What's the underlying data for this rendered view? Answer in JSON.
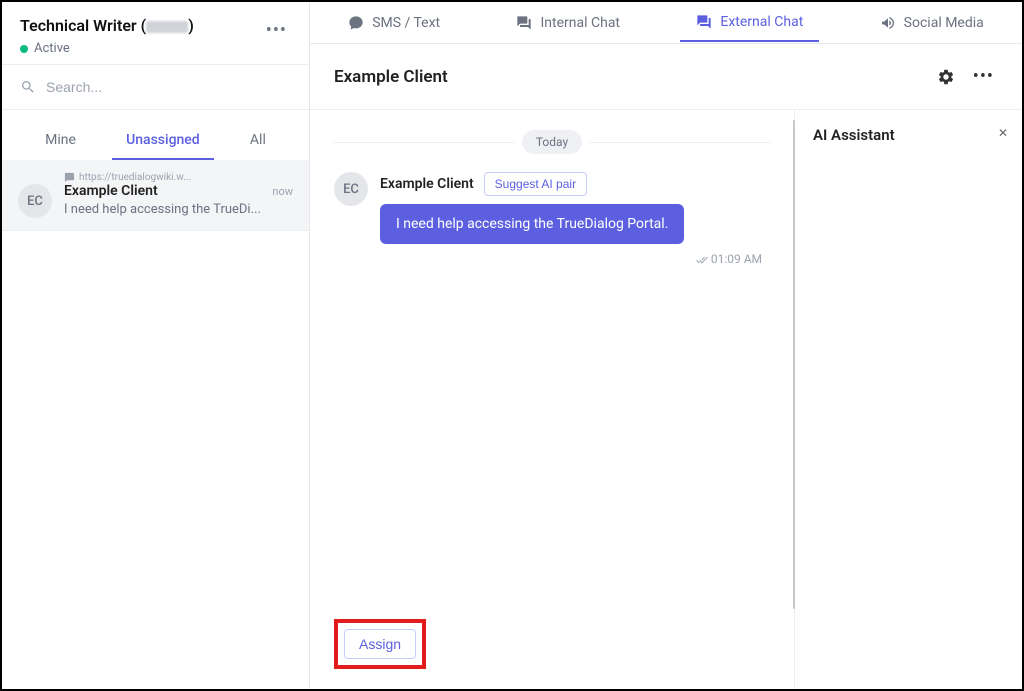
{
  "sidebar": {
    "user_name_prefix": "Technical Writer (",
    "user_name_suffix": ")",
    "status": "Active",
    "search_placeholder": "Search...",
    "filter_tabs": [
      "Mine",
      "Unassigned",
      "All"
    ],
    "conversation": {
      "avatar_initials": "EC",
      "source_url": "https://truedialogwiki.w...",
      "title": "Example Client",
      "time": "now",
      "preview": "I need help accessing the TrueDi..."
    }
  },
  "top_tabs": [
    {
      "label": "SMS / Text"
    },
    {
      "label": "Internal Chat"
    },
    {
      "label": "External Chat"
    },
    {
      "label": "Social Media"
    }
  ],
  "content": {
    "client_name": "Example Client",
    "date_separator": "Today",
    "message": {
      "avatar_initials": "EC",
      "sender": "Example Client",
      "suggest_label": "Suggest AI pair",
      "text": "I need help accessing the TrueDialog Portal.",
      "time": "01:09 AM"
    },
    "assign_label": "Assign"
  },
  "ai_panel": {
    "title": "AI Assistant"
  }
}
